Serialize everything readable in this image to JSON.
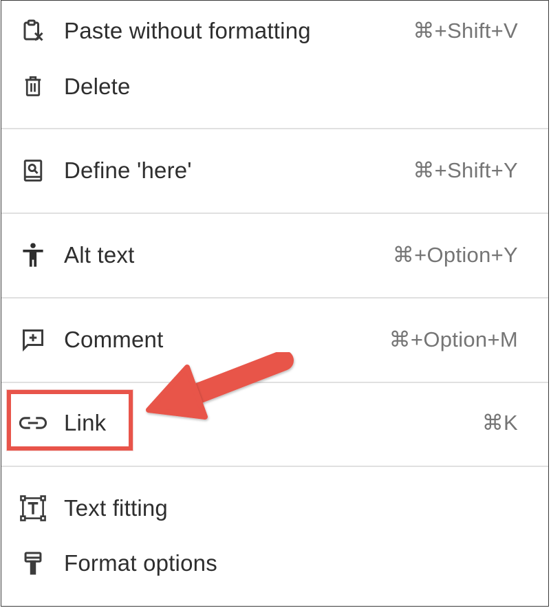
{
  "menu": {
    "items": [
      {
        "label": "Paste without formatting",
        "shortcut": "⌘+Shift+V",
        "icon": "paste-without-formatting-icon"
      },
      {
        "label": "Delete",
        "shortcut": "",
        "icon": "trash-icon"
      },
      {
        "label": "Define 'here'",
        "shortcut": "⌘+Shift+Y",
        "icon": "dictionary-icon"
      },
      {
        "label": "Alt text",
        "shortcut": "⌘+Option+Y",
        "icon": "accessibility-icon"
      },
      {
        "label": "Comment",
        "shortcut": "⌘+Option+M",
        "icon": "add-comment-icon"
      },
      {
        "label": "Link",
        "shortcut": "⌘K",
        "icon": "link-icon"
      },
      {
        "label": "Text fitting",
        "shortcut": "",
        "icon": "text-fitting-icon"
      },
      {
        "label": "Format options",
        "shortcut": "",
        "icon": "format-paint-icon"
      }
    ]
  },
  "annotation": {
    "highlight_target": "Link",
    "color": "#e8544a"
  },
  "colors": {
    "label": "#2e2e2e",
    "shortcut": "#757575",
    "divider": "#e0e0e0",
    "border": "#3a3a3a"
  }
}
